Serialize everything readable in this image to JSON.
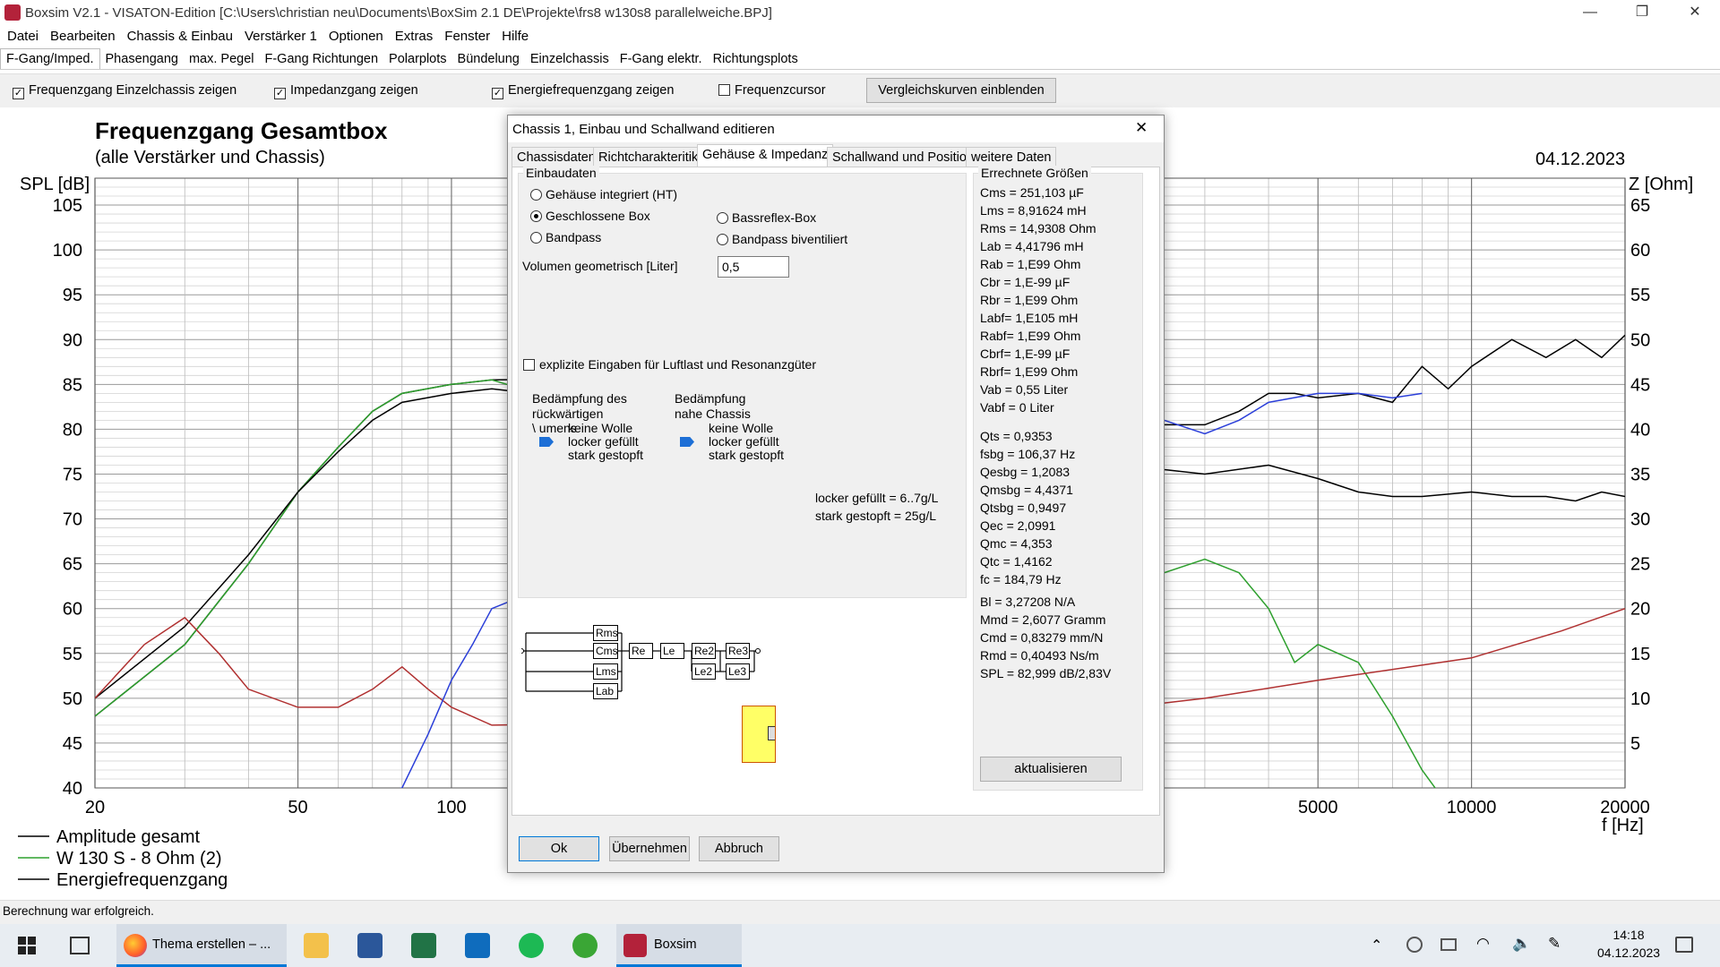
{
  "window": {
    "title": "Boxsim V2.1 - VISATON-Edition [C:\\Users\\christian neu\\Documents\\BoxSim 2.1 DE\\Projekte\\frs8 w130s8 parallelweiche.BPJ]",
    "minimize": "—",
    "maximize": "❐",
    "close": "✕"
  },
  "menu": [
    "Datei",
    "Bearbeiten",
    "Chassis & Einbau",
    "Verstärker 1",
    "Optionen",
    "Extras",
    "Fenster",
    "Hilfe"
  ],
  "tabs": [
    "F-Gang/Imped.",
    "Phasengang",
    "max. Pegel",
    "F-Gang Richtungen",
    "Polarplots",
    "Bündelung",
    "Einzelchassis",
    "F-Gang elektr.",
    "Richtungsplots"
  ],
  "toolbar": {
    "show_single": "Frequenzgang Einzelchassis zeigen",
    "show_impedance": "Impedanzgang zeigen",
    "show_energy": "Energiefrequenzgang zeigen",
    "cursor": "Frequenzcursor",
    "compare_btn": "Vergleichskurven einblenden"
  },
  "plot": {
    "title": "Frequenzgang Gesamtbox",
    "subtitle": "(alle Verstärker und Chassis)",
    "date": "04.12.2023",
    "ylabel_left": "SPL [dB]",
    "ylabel_right": "Z [Ohm]",
    "xlabel": "f [Hz]",
    "legend": [
      "Amplitude gesamt",
      "W 130 S - 8 Ohm (2)",
      "Energiefrequenzgang"
    ],
    "legend_colors": [
      "#000000",
      "#2ea02e",
      "#000000"
    ]
  },
  "chart_data": {
    "type": "line",
    "title": "Frequenzgang Gesamtbox",
    "subtitle": "(alle Verstärker und Chassis)",
    "xlabel": "f [Hz]",
    "ylabel": "SPL [dB]",
    "y2label": "Z [Ohm]",
    "x_scale": "log",
    "xlim": [
      20,
      20000
    ],
    "ylim": [
      40,
      108
    ],
    "y2lim": [
      0,
      68
    ],
    "x_ticks": [
      20,
      50,
      100,
      5000,
      10000,
      20000
    ],
    "y_ticks": [
      40,
      45,
      50,
      55,
      60,
      65,
      70,
      75,
      80,
      85,
      90,
      95,
      100,
      105
    ],
    "y2_ticks": [
      5,
      10,
      15,
      20,
      25,
      30,
      35,
      40,
      45,
      50,
      55,
      60,
      65
    ],
    "grid": true,
    "legend_position": "bottom-left",
    "series": [
      {
        "name": "Amplitude gesamt",
        "color": "#000000",
        "axis": "left",
        "x": [
          20,
          30,
          40,
          50,
          60,
          70,
          80,
          100,
          120,
          1500,
          2000,
          2500,
          3000,
          3500,
          4000,
          4500,
          5000,
          6000,
          7000,
          8000,
          9000,
          10000,
          12000,
          14000,
          16000,
          18000,
          20000
        ],
        "y": [
          48,
          56,
          65,
          73,
          78,
          82,
          84,
          85,
          85.5,
          86,
          83,
          80.5,
          80.5,
          82,
          84,
          84,
          83.5,
          84,
          83,
          87,
          84.5,
          87,
          90,
          88,
          90,
          88,
          90.5
        ]
      },
      {
        "name": "W 130 S - 8 Ohm (2)",
        "color": "#2ea02e",
        "axis": "left",
        "x": [
          20,
          30,
          40,
          50,
          60,
          70,
          80,
          100,
          120,
          1500,
          2000,
          2500,
          3000,
          3500,
          4000,
          4500,
          5000,
          6000,
          7000,
          8000,
          9000
        ],
        "y": [
          48,
          56,
          65,
          73,
          78,
          82,
          84,
          85,
          85.5,
          67,
          65,
          64,
          65.5,
          64,
          60,
          54,
          56,
          54,
          48,
          42,
          38
        ]
      },
      {
        "name": "Energiefrequenzgang",
        "color": "#000000",
        "axis": "left",
        "x": [
          20,
          30,
          40,
          50,
          60,
          70,
          80,
          100,
          120,
          1500,
          2000,
          2500,
          3000,
          4000,
          5000,
          6000,
          7000,
          8000,
          10000,
          12000,
          14000,
          16000,
          18000,
          20000
        ],
        "y": [
          50,
          58,
          66,
          73,
          77.5,
          81,
          83,
          84,
          84.5,
          77.5,
          77,
          75.5,
          75,
          76,
          74.5,
          73,
          72.5,
          72.5,
          73,
          72.5,
          72.5,
          72,
          73,
          72.5
        ]
      },
      {
        "name": "Impedanz",
        "color": "#b03030",
        "axis": "right",
        "x": [
          20,
          25,
          30,
          35,
          40,
          50,
          60,
          70,
          80,
          90,
          100,
          120,
          1500,
          3000,
          5000,
          10000,
          15000,
          20000
        ],
        "y": [
          10,
          16,
          19,
          15,
          11,
          9,
          9,
          11,
          13.5,
          11,
          9,
          7,
          8,
          10,
          12,
          14.5,
          17.5,
          20
        ]
      },
      {
        "name": "Chassis 1",
        "color": "#2b3fd9",
        "axis": "left",
        "x": [
          60,
          80,
          90,
          100,
          110,
          120,
          1500,
          2000,
          2500,
          3000,
          3500,
          4000,
          5000,
          6000,
          7000,
          8000
        ],
        "y": [
          38,
          40,
          46,
          52,
          56,
          60,
          85,
          84.5,
          81,
          79.5,
          81,
          83,
          84,
          84,
          83.5,
          84
        ]
      }
    ]
  },
  "dialog": {
    "title": "Chassis 1, Einbau und Schallwand editieren",
    "close": "✕",
    "tabs": [
      "Chassisdaten",
      "Richtcharakteritik",
      "Gehäuse & Impedanz",
      "Schallwand und Position",
      "weitere Daten"
    ],
    "group_install": "Einbaudaten",
    "radios": {
      "integrated": "Gehäuse integriert (HT)",
      "closed": "Geschlossene Box",
      "bandpass": "Bandpass",
      "bassreflex": "Bassreflex-Box",
      "bandpass_bivent": "Bandpass biventiliert"
    },
    "volume_label": "Volumen geometrisch [Liter]",
    "volume_value": "0,5",
    "explicit_label": "explizite Eingaben für Luftlast und Resonanzgüter",
    "damping_rear_title": "Bedämpfung des rückwärtigen Volumens",
    "damping_rear_fragment": "\\ umens",
    "damping_near_title": "Bedämpfung nahe Chassis",
    "damping_options": [
      "keine Wolle",
      "locker gefüllt",
      "stark gestopft"
    ],
    "density_note_1": "locker gefüllt = 6..7g/L",
    "density_note_2": "stark gestopft = 25g/L",
    "circuit": {
      "rms": "Rms",
      "cms": "Cms",
      "lms": "Lms",
      "lab": "Lab",
      "re": "Re",
      "le": "Le",
      "re2": "Re2",
      "re3": "Re3",
      "le2": "Le2",
      "le3": "Le3"
    },
    "results_title": "Errechnete Größen",
    "results_a": [
      "Cms = 251,103 µF",
      "Lms = 8,91624 mH",
      "Rms = 14,9308 Ohm",
      "Lab = 4,41796 mH",
      "Rab = 1,E99 Ohm",
      "Cbr = 1,E-99 µF",
      "Rbr = 1,E99 Ohm",
      "Labf= 1,E105 mH",
      "Rabf= 1,E99 Ohm",
      "Cbrf= 1,E-99 µF",
      "Rbrf= 1,E99 Ohm",
      "Vab = 0,55 Liter",
      "Vabf = 0 Liter"
    ],
    "results_b": [
      "Qts = 0,9353",
      "fsbg = 106,37 Hz",
      "Qesbg = 1,2083",
      "Qmsbg = 4,4371",
      "Qtsbg = 0,9497",
      "Qec = 2,0991",
      "Qmc = 4,353",
      "Qtc = 1,4162",
      "fc  = 184,79 Hz"
    ],
    "results_c": [
      "Bl  = 3,27208 N/A",
      "Mmd = 2,6077 Gramm",
      "Cmd = 0,83279 mm/N",
      "Rmd = 0,40493 Ns/m",
      "SPL = 82,999 dB/2,83V"
    ],
    "update_btn": "aktualisieren",
    "ok_btn": "Ok",
    "apply_btn": "Übernehmen",
    "cancel_btn": "Abbruch"
  },
  "status": "Berechnung war erfolgreich.",
  "taskbar": {
    "firefox_label": "Thema erstellen – ...",
    "boxsim_label": "Boxsim",
    "time": "14:18",
    "date": "04.12.2023"
  }
}
